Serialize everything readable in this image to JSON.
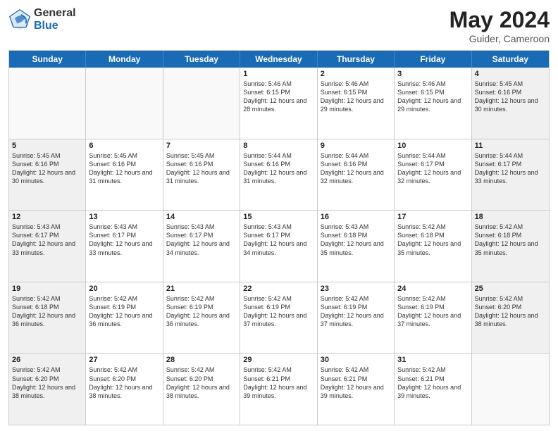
{
  "header": {
    "logo_general": "General",
    "logo_blue": "Blue",
    "title": "May 2024",
    "location": "Guider, Cameroon"
  },
  "days_of_week": [
    "Sunday",
    "Monday",
    "Tuesday",
    "Wednesday",
    "Thursday",
    "Friday",
    "Saturday"
  ],
  "weeks": [
    [
      {
        "day": "",
        "info": "",
        "empty": true
      },
      {
        "day": "",
        "info": "",
        "empty": true
      },
      {
        "day": "",
        "info": "",
        "empty": true
      },
      {
        "day": "1",
        "info": "Sunrise: 5:46 AM\nSunset: 6:15 PM\nDaylight: 12 hours\nand 28 minutes.",
        "empty": false
      },
      {
        "day": "2",
        "info": "Sunrise: 5:46 AM\nSunset: 6:15 PM\nDaylight: 12 hours\nand 29 minutes.",
        "empty": false
      },
      {
        "day": "3",
        "info": "Sunrise: 5:46 AM\nSunset: 6:15 PM\nDaylight: 12 hours\nand 29 minutes.",
        "empty": false
      },
      {
        "day": "4",
        "info": "Sunrise: 5:45 AM\nSunset: 6:16 PM\nDaylight: 12 hours\nand 30 minutes.",
        "empty": false
      }
    ],
    [
      {
        "day": "5",
        "info": "Sunrise: 5:45 AM\nSunset: 6:16 PM\nDaylight: 12 hours\nand 30 minutes.",
        "empty": false
      },
      {
        "day": "6",
        "info": "Sunrise: 5:45 AM\nSunset: 6:16 PM\nDaylight: 12 hours\nand 31 minutes.",
        "empty": false
      },
      {
        "day": "7",
        "info": "Sunrise: 5:45 AM\nSunset: 6:16 PM\nDaylight: 12 hours\nand 31 minutes.",
        "empty": false
      },
      {
        "day": "8",
        "info": "Sunrise: 5:44 AM\nSunset: 6:16 PM\nDaylight: 12 hours\nand 31 minutes.",
        "empty": false
      },
      {
        "day": "9",
        "info": "Sunrise: 5:44 AM\nSunset: 6:16 PM\nDaylight: 12 hours\nand 32 minutes.",
        "empty": false
      },
      {
        "day": "10",
        "info": "Sunrise: 5:44 AM\nSunset: 6:17 PM\nDaylight: 12 hours\nand 32 minutes.",
        "empty": false
      },
      {
        "day": "11",
        "info": "Sunrise: 5:44 AM\nSunset: 6:17 PM\nDaylight: 12 hours\nand 33 minutes.",
        "empty": false
      }
    ],
    [
      {
        "day": "12",
        "info": "Sunrise: 5:43 AM\nSunset: 6:17 PM\nDaylight: 12 hours\nand 33 minutes.",
        "empty": false
      },
      {
        "day": "13",
        "info": "Sunrise: 5:43 AM\nSunset: 6:17 PM\nDaylight: 12 hours\nand 33 minutes.",
        "empty": false
      },
      {
        "day": "14",
        "info": "Sunrise: 5:43 AM\nSunset: 6:17 PM\nDaylight: 12 hours\nand 34 minutes.",
        "empty": false
      },
      {
        "day": "15",
        "info": "Sunrise: 5:43 AM\nSunset: 6:17 PM\nDaylight: 12 hours\nand 34 minutes.",
        "empty": false
      },
      {
        "day": "16",
        "info": "Sunrise: 5:43 AM\nSunset: 6:18 PM\nDaylight: 12 hours\nand 35 minutes.",
        "empty": false
      },
      {
        "day": "17",
        "info": "Sunrise: 5:42 AM\nSunset: 6:18 PM\nDaylight: 12 hours\nand 35 minutes.",
        "empty": false
      },
      {
        "day": "18",
        "info": "Sunrise: 5:42 AM\nSunset: 6:18 PM\nDaylight: 12 hours\nand 35 minutes.",
        "empty": false
      }
    ],
    [
      {
        "day": "19",
        "info": "Sunrise: 5:42 AM\nSunset: 6:18 PM\nDaylight: 12 hours\nand 36 minutes.",
        "empty": false
      },
      {
        "day": "20",
        "info": "Sunrise: 5:42 AM\nSunset: 6:19 PM\nDaylight: 12 hours\nand 36 minutes.",
        "empty": false
      },
      {
        "day": "21",
        "info": "Sunrise: 5:42 AM\nSunset: 6:19 PM\nDaylight: 12 hours\nand 36 minutes.",
        "empty": false
      },
      {
        "day": "22",
        "info": "Sunrise: 5:42 AM\nSunset: 6:19 PM\nDaylight: 12 hours\nand 37 minutes.",
        "empty": false
      },
      {
        "day": "23",
        "info": "Sunrise: 5:42 AM\nSunset: 6:19 PM\nDaylight: 12 hours\nand 37 minutes.",
        "empty": false
      },
      {
        "day": "24",
        "info": "Sunrise: 5:42 AM\nSunset: 6:19 PM\nDaylight: 12 hours\nand 37 minutes.",
        "empty": false
      },
      {
        "day": "25",
        "info": "Sunrise: 5:42 AM\nSunset: 6:20 PM\nDaylight: 12 hours\nand 38 minutes.",
        "empty": false
      }
    ],
    [
      {
        "day": "26",
        "info": "Sunrise: 5:42 AM\nSunset: 6:20 PM\nDaylight: 12 hours\nand 38 minutes.",
        "empty": false
      },
      {
        "day": "27",
        "info": "Sunrise: 5:42 AM\nSunset: 6:20 PM\nDaylight: 12 hours\nand 38 minutes.",
        "empty": false
      },
      {
        "day": "28",
        "info": "Sunrise: 5:42 AM\nSunset: 6:20 PM\nDaylight: 12 hours\nand 38 minutes.",
        "empty": false
      },
      {
        "day": "29",
        "info": "Sunrise: 5:42 AM\nSunset: 6:21 PM\nDaylight: 12 hours\nand 39 minutes.",
        "empty": false
      },
      {
        "day": "30",
        "info": "Sunrise: 5:42 AM\nSunset: 6:21 PM\nDaylight: 12 hours\nand 39 minutes.",
        "empty": false
      },
      {
        "day": "31",
        "info": "Sunrise: 5:42 AM\nSunset: 6:21 PM\nDaylight: 12 hours\nand 39 minutes.",
        "empty": false
      },
      {
        "day": "",
        "info": "",
        "empty": true
      }
    ]
  ]
}
